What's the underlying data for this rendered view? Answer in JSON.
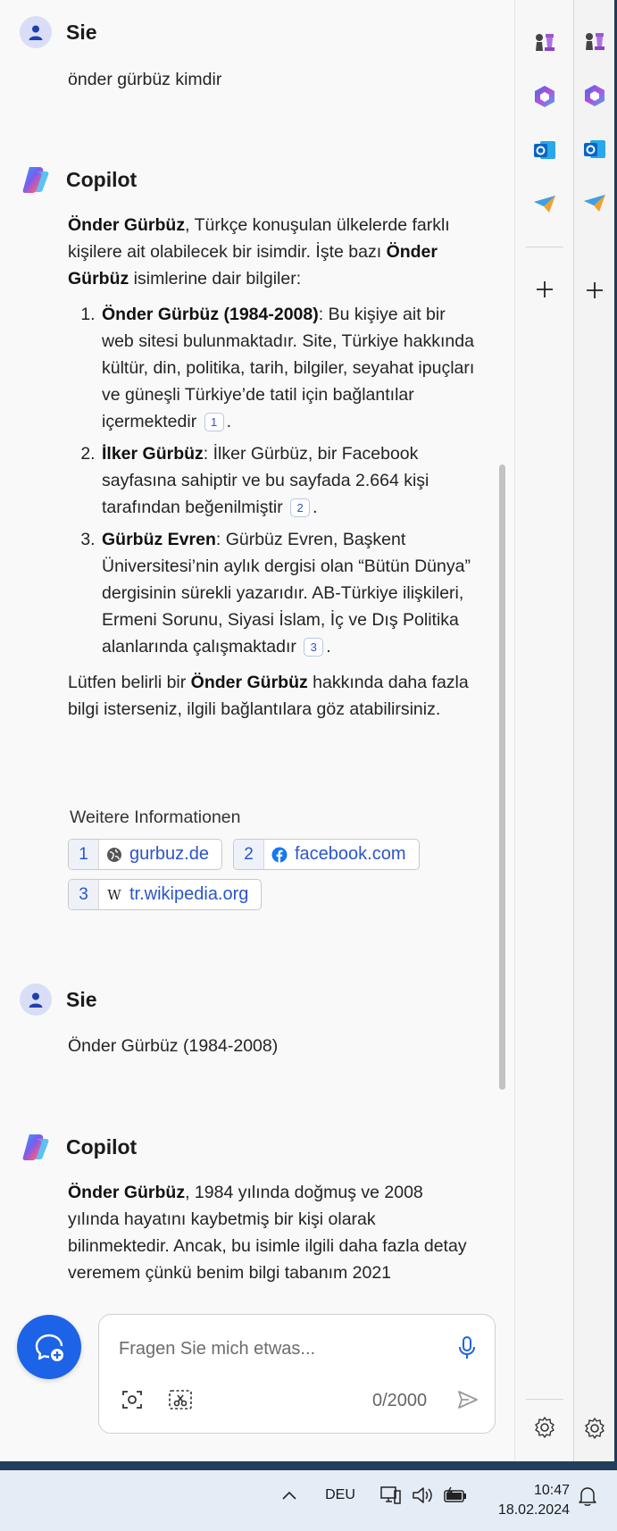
{
  "chat": {
    "user_name": "Sie",
    "copilot_name": "Copilot",
    "q1": "önder gürbüz kimdir",
    "a1": {
      "intro_b1": "Önder Gürbüz",
      "intro_t1": ", Türkçe konuşulan ülkelerde farklı kişilere ait olabilecek bir isimdir. İşte bazı ",
      "intro_b2": "Önder Gürbüz",
      "intro_t2": " isimlerine dair bilgiler:",
      "items": [
        {
          "bold": "Önder Gürbüz (1984-2008)",
          "text": ": Bu kişiye ait bir web sitesi bulunmaktadır. Site, Türkiye hakkında kültür, din, politika, tarih, bilgiler, seyahat ipuçları ve güneşli Türkiye’de tatil için bağlantılar içermektedir",
          "cite": "1",
          "end": "."
        },
        {
          "bold": "İlker Gürbüz",
          "text": ": İlker Gürbüz, bir Facebook sayfasına sahiptir ve bu sayfada 2.664 kişi tarafından beğenilmiştir",
          "cite": "2",
          "end": "."
        },
        {
          "bold": "Gürbüz Evren",
          "text": ": Gürbüz Evren, Başkent Üniversitesi’nin aylık dergisi olan “Bütün Dünya” dergisinin sürekli yazarıdır. AB-Türkiye ilişkileri, Ermeni Sorunu, Siyasi İslam, İç ve Dış Politika alanlarında çalışmaktadır",
          "cite": "3",
          "end": "."
        }
      ],
      "outro_t1": "Lütfen belirli bir ",
      "outro_b1": "Önder Gürbüz",
      "outro_t2": " hakkında daha fazla bilgi isterseniz, ilgili bağlantılara göz atabilirsiniz.",
      "more_title": "Weitere Informationen",
      "sources": [
        {
          "num": "1",
          "label": "gurbuz.de",
          "icon": "globe-icon"
        },
        {
          "num": "2",
          "label": "facebook.com",
          "icon": "facebook-icon"
        },
        {
          "num": "3",
          "label": "tr.wikipedia.org",
          "icon": "wikipedia-icon"
        }
      ]
    },
    "q2": "Önder Gürbüz (1984-2008)",
    "a2": {
      "b1": "Önder Gürbüz",
      "t1": ", 1984 yılında doğmuş ve 2008 yılında hayatını kaybetmiş bir kişi olarak bilinmektedir. Ancak, bu isimle ilgili daha fazla detay veremem çünkü benim bilgi tabanım 2021"
    }
  },
  "input": {
    "placeholder": "Fragen Sie mich etwas...",
    "value": "",
    "counter": "0/2000"
  },
  "rail_icons": [
    "chess-icon",
    "microsoft365-icon",
    "outlook-icon",
    "telegram-icon",
    "add-icon",
    "settings-icon"
  ],
  "taskbar": {
    "language": "DEU",
    "time": "10:47",
    "date": "18.02.2024"
  },
  "colors": {
    "accent": "#1c63e8",
    "link": "#2b56c9",
    "taskbar": "#e4ecf6"
  }
}
